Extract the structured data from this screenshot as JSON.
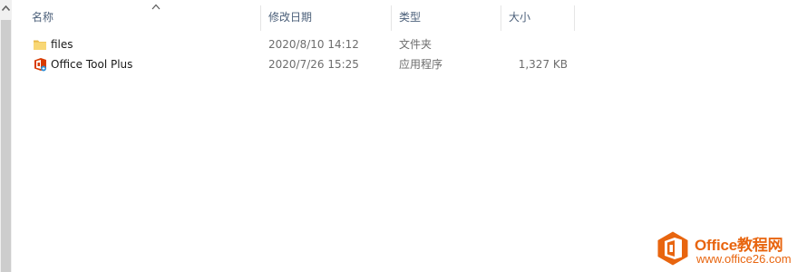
{
  "columns": {
    "name": "名称",
    "date": "修改日期",
    "type": "类型",
    "size": "大小"
  },
  "sort": {
    "column": "name",
    "direction": "ascending"
  },
  "files": [
    {
      "name": "files",
      "icon": "folder-icon",
      "date": "2020/8/10 14:12",
      "type": "文件夹",
      "size": ""
    },
    {
      "name": "Office Tool Plus",
      "icon": "office-tool-plus-app-icon",
      "date": "2020/7/26 15:25",
      "type": "应用程序",
      "size": "1,327 KB"
    }
  ],
  "watermark": {
    "brand": "Office教程网",
    "site": "www.office26.com"
  },
  "colors": {
    "header_text": "#4c607a",
    "secondary_text": "#6d6d6d",
    "folder": "#f8d775",
    "office_red": "#d83b01",
    "watermark": "#e8650f"
  }
}
